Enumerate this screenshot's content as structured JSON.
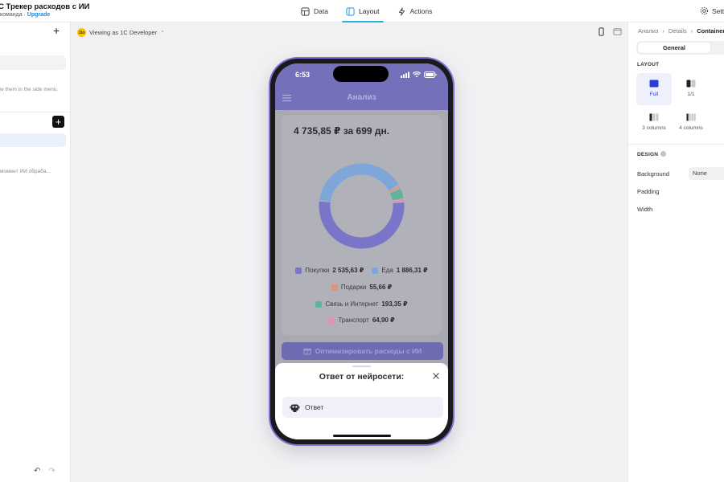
{
  "app": {
    "title": "С Трекер расходов с ИИ",
    "subtitle_team": "команда · ",
    "upgrade_label": "Upgrade"
  },
  "top_tabs": [
    {
      "label": "Data",
      "icon": "table-icon"
    },
    {
      "label": "Layout",
      "icon": "layout-icon",
      "active": true
    },
    {
      "label": "Actions",
      "icon": "lightning-icon"
    }
  ],
  "settings_label": "Settings",
  "left_panel": {
    "hint_text": "w them in the side menu.",
    "item_text": "момент ИИ обраба..."
  },
  "canvas": {
    "viewing_badge": "1to",
    "viewing_label": "Viewing as 1C Developer"
  },
  "phone": {
    "time": "6:53",
    "screen_title": "Анализ",
    "summary": "4 735,85 ₽ за 699 дн.",
    "optimize_button": "Оптимизировать расходы с ИИ",
    "sheet_title": "Ответ от нейросети:",
    "answer_label": "Ответ"
  },
  "chart_data": {
    "type": "pie",
    "donut": true,
    "series": [
      {
        "name": "Покупки",
        "value": 2535.63,
        "value_label": "2 535,63 ₽",
        "color": "#7b75c9"
      },
      {
        "name": "Еда",
        "value": 1886.31,
        "value_label": "1 886,31 ₽",
        "color": "#7ea6d8"
      },
      {
        "name": "Подарки",
        "value": 55.66,
        "value_label": "55,66 ₽",
        "color": "#e0957a"
      },
      {
        "name": "Связь и Интернет",
        "value": 193.35,
        "value_label": "193,35 ₽",
        "color": "#5fb39a"
      },
      {
        "name": "Транспорт",
        "value": 64.9,
        "value_label": "64,90 ₽",
        "color": "#e493ad"
      }
    ]
  },
  "right_panel": {
    "breadcrumbs": [
      "Анализ",
      "Details",
      "Container"
    ],
    "segment_general": "General",
    "layout_title": "LAYOUT",
    "layout_options": [
      "Full",
      "1/1",
      "3 columns",
      "4 columns"
    ],
    "design_title": "DESIGN",
    "background_label": "Background",
    "background_value": "None",
    "padding_label": "Padding",
    "width_label": "Width"
  }
}
